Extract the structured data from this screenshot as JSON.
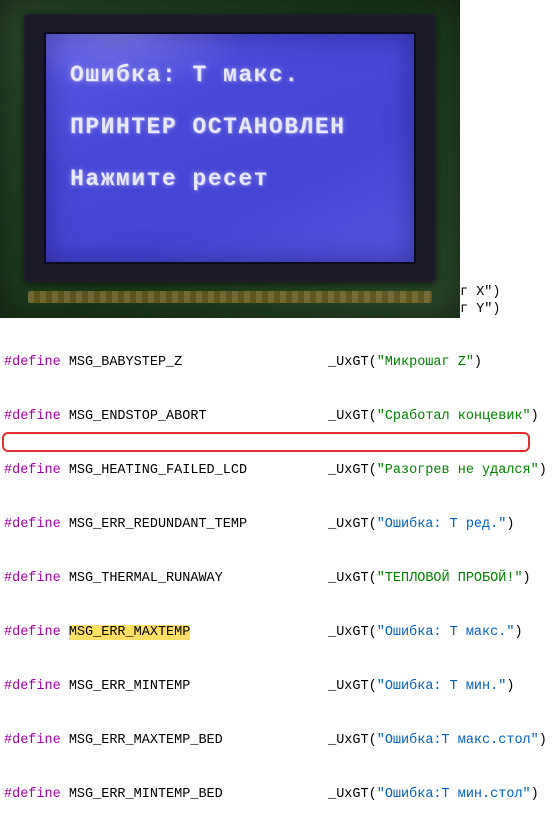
{
  "lcd": {
    "line1": "Ошибка: Т макс.",
    "line2": "ПРИНТЕР ОСТАНОВЛЕН",
    "line3": "Нажмите ресет"
  },
  "frag": {
    "a": "г X\")",
    "b": "г Y\")"
  },
  "code": [
    {
      "def": "#define",
      "name": "MSG_BABYSTEP_Z",
      "hl": false,
      "fn": "_UxGT",
      "str": "\"Микрошаг Z\"",
      "blue": false
    },
    {
      "def": "#define",
      "name": "MSG_ENDSTOP_ABORT",
      "hl": false,
      "fn": "_UxGT",
      "str": "\"Сработал концевик\"",
      "blue": false
    },
    {
      "def": "#define",
      "name": "MSG_HEATING_FAILED_LCD",
      "hl": false,
      "fn": "_UxGT",
      "str": "\"Разогрев не удался\"",
      "blue": false
    },
    {
      "def": "#define",
      "name": "MSG_ERR_REDUNDANT_TEMP",
      "hl": false,
      "fn": "_UxGT",
      "str": "\"Ошибка: Т ред.\"",
      "blue": true
    },
    {
      "def": "#define",
      "name": "MSG_THERMAL_RUNAWAY",
      "hl": false,
      "fn": "_UxGT",
      "str": "\"ТЕПЛОВОЙ ПРОБОЙ!\"",
      "blue": false
    },
    {
      "def": "#define",
      "name": "MSG_ERR_MAXTEMP",
      "hl": true,
      "fn": "_UxGT",
      "str": "\"Ошибка: Т макс.\"",
      "blue": true
    },
    {
      "def": "#define",
      "name": "MSG_ERR_MINTEMP",
      "hl": false,
      "fn": "_UxGT",
      "str": "\"Ошибка: Т мин.\"",
      "blue": true
    },
    {
      "def": "#define",
      "name": "MSG_ERR_MAXTEMP_BED",
      "hl": false,
      "fn": "_UxGT",
      "str": "\"Ошибка:Т макс.стол\"",
      "blue": true
    },
    {
      "def": "#define",
      "name": "MSG_ERR_MINTEMP_BED",
      "hl": false,
      "fn": "_UxGT",
      "str": "\"Ошибка:Т мин.стол\"",
      "blue": true
    }
  ]
}
